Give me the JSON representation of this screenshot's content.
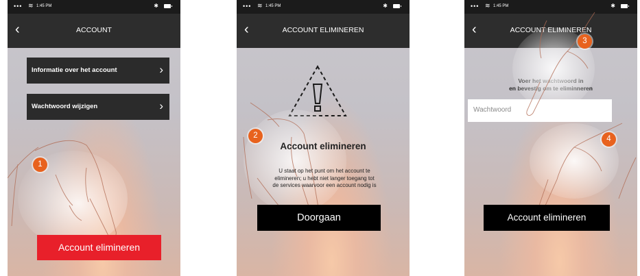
{
  "status_bar": {
    "time": "1:45 PM"
  },
  "screen1": {
    "title": "ACCOUNT",
    "items": [
      {
        "label": "Informatie over het account"
      },
      {
        "label": "Wachtwoord wijzigen"
      }
    ],
    "button": "Account elimineren",
    "step": "1"
  },
  "screen2": {
    "title": "ACCOUNT ELIMINEREN",
    "heading": "Account elimineren",
    "description": [
      "U staat op het punt om het account te",
      "elimineren; u hebt niet langer toegang tot",
      "de services waarvoor een account nodig is"
    ],
    "button": "Doorgaan",
    "step": "2"
  },
  "screen3": {
    "title": "ACCOUNT ELIMINEREN",
    "prompt": [
      "Voer het wachtwoord in",
      "en bevestig om te eliminneren"
    ],
    "password_placeholder": "Wachtwoord",
    "button": "Account elimineren",
    "steps": [
      "3",
      "4"
    ]
  },
  "colors": {
    "accent_red": "#e8202a",
    "badge_orange": "#e8621e",
    "navbar": "#2d2d2d"
  }
}
